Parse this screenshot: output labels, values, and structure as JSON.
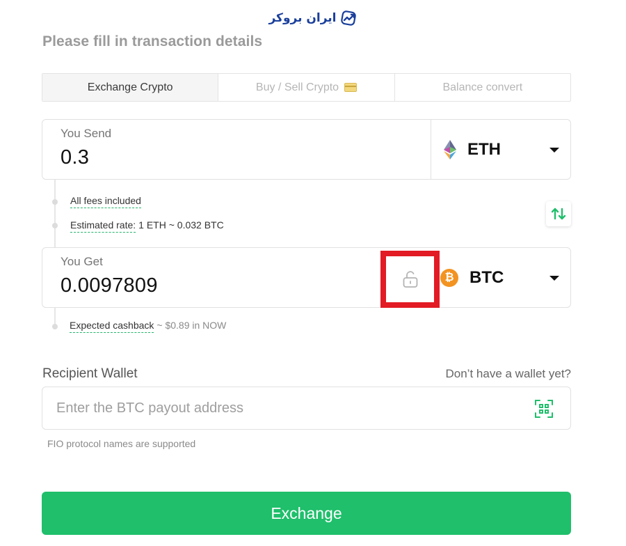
{
  "logo": {
    "text": "ایران بروکر"
  },
  "page_title": "Please fill in transaction details",
  "tabs": [
    {
      "label": "Exchange Crypto",
      "active": true
    },
    {
      "label": "Buy / Sell Crypto",
      "active": false
    },
    {
      "label": "Balance convert",
      "active": false
    }
  ],
  "send": {
    "label": "You Send",
    "value": "0.3",
    "currency": "ETH"
  },
  "fees": {
    "fees_label": "All fees included",
    "rate_label": "Estimated rate:",
    "rate_value": "1 ETH ~ 0.032 BTC"
  },
  "get": {
    "label": "You Get",
    "value": "0.0097809",
    "currency": "BTC",
    "coin_symbol": "₿"
  },
  "cashback": {
    "label": "Expected cashback",
    "value": "~ $0.89 in NOW"
  },
  "recipient": {
    "label": "Recipient Wallet",
    "no_wallet_link": "Don’t have a wallet yet?",
    "placeholder": "Enter the BTC payout address",
    "note": "FIO protocol names are supported"
  },
  "exchange_button": "Exchange",
  "colors": {
    "accent": "#1fbf6b",
    "highlight": "#e21b24",
    "btc": "#f39321",
    "logo": "#1a3f9c"
  }
}
